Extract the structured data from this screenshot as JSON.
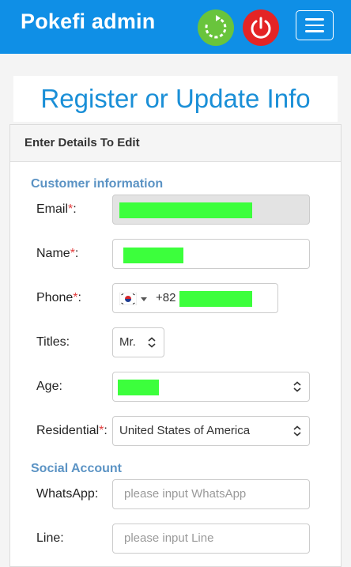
{
  "header": {
    "brand": "Pokefi admin",
    "refresh_icon": "refresh-icon",
    "power_icon": "power-icon",
    "menu_icon": "hamburger-menu-icon",
    "bar_color": "#0f8fe6"
  },
  "page": {
    "title": "Register or Update Info"
  },
  "panel": {
    "heading": "Enter Details To Edit"
  },
  "customer_section": {
    "title": "Customer information",
    "email": {
      "label": "Email",
      "required": "*",
      "suffix": ":"
    },
    "name": {
      "label": "Name",
      "required": "*",
      "suffix": ":"
    },
    "phone": {
      "label": "Phone",
      "required": "*",
      "suffix": ":",
      "prefix": "+82",
      "flag_icon": "south-korea-flag-icon"
    },
    "titles": {
      "label": "Titles:",
      "value": "Mr."
    },
    "age": {
      "label": "Age:"
    },
    "residential": {
      "label": "Residential",
      "required": "*",
      "suffix": ":",
      "value": "United States of America"
    }
  },
  "social_section": {
    "title": "Social Account",
    "whatsapp": {
      "label": "WhatsApp:",
      "placeholder": "please input WhatsApp"
    },
    "line": {
      "label": "Line:",
      "placeholder": "please input Line"
    }
  }
}
